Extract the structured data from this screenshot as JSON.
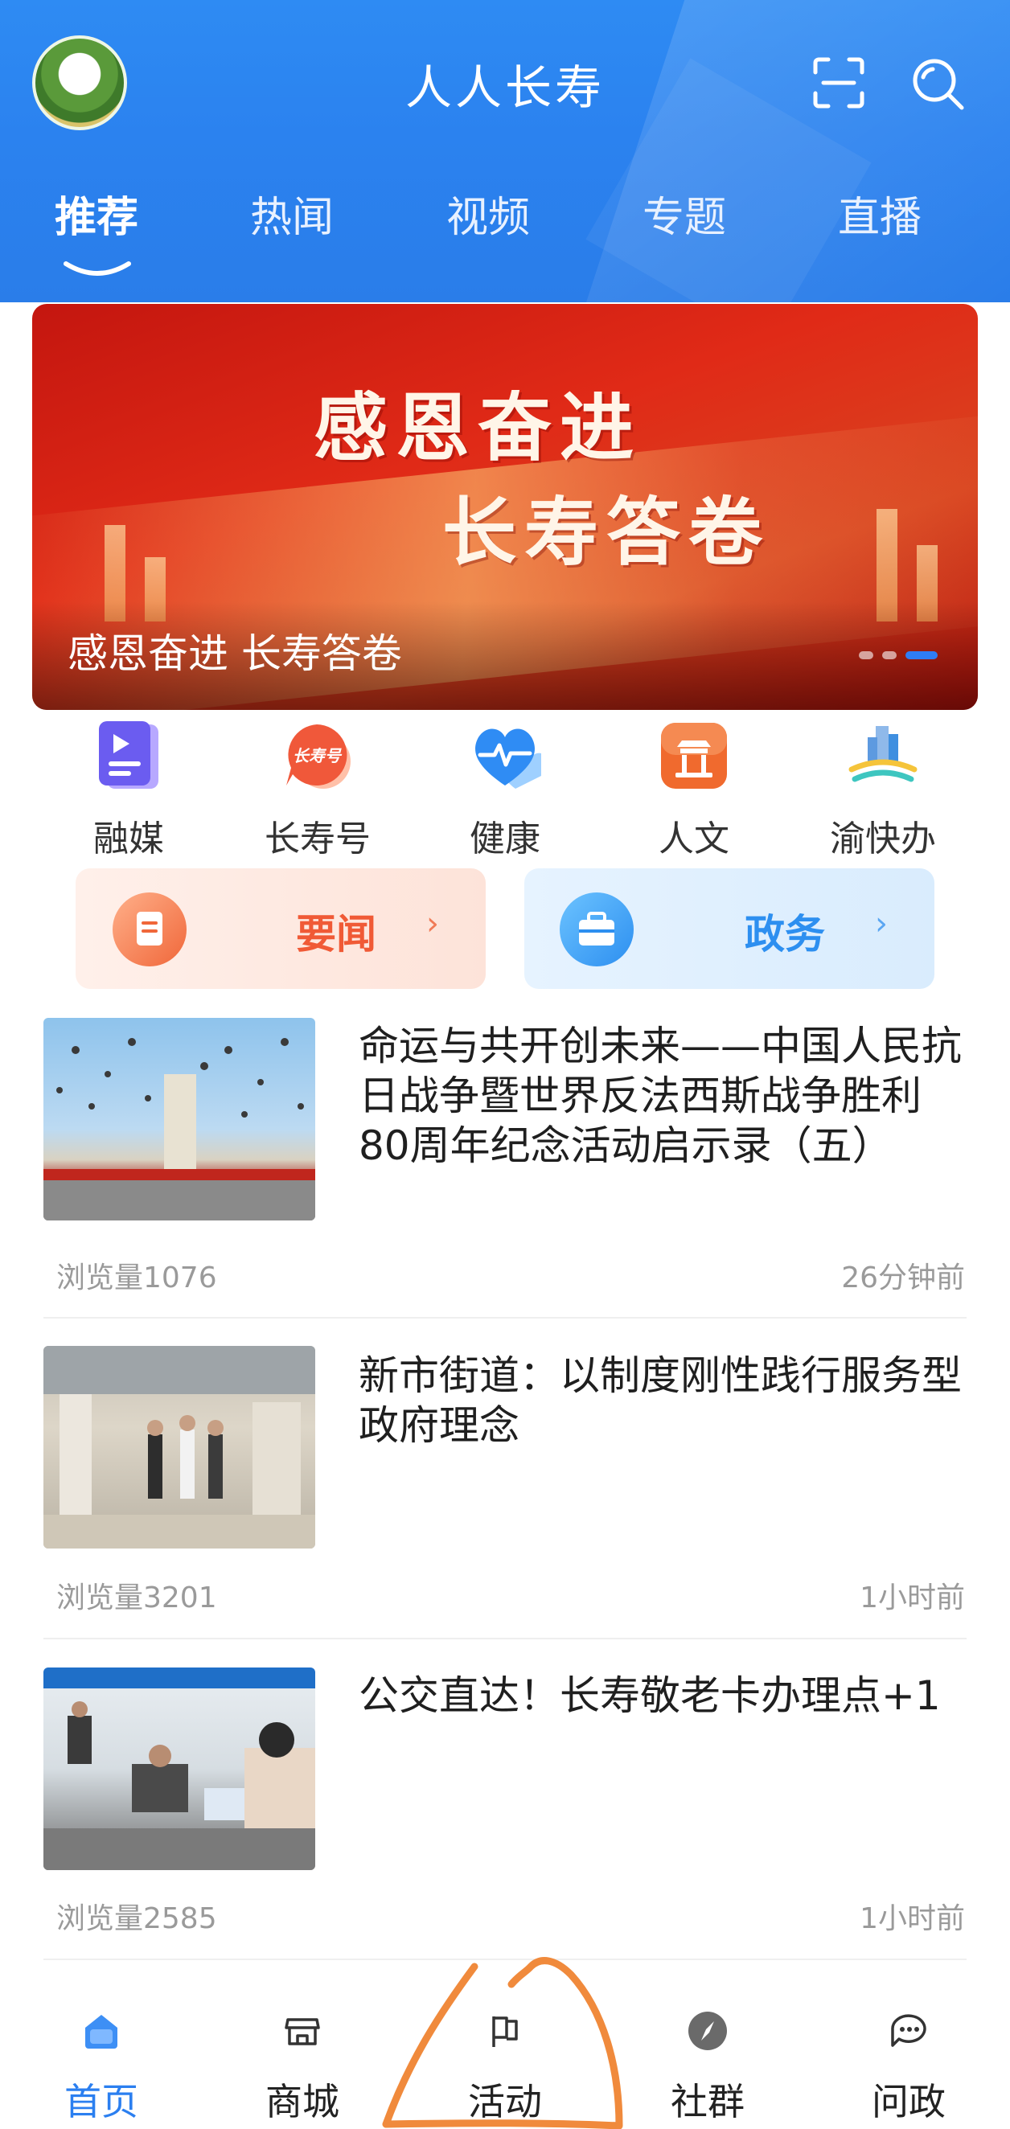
{
  "header": {
    "title": "人人长寿",
    "avatar_icon": "app-logo-icon",
    "scan_icon": "scan-icon",
    "search_icon": "search-icon"
  },
  "tabs": [
    {
      "label": "推荐",
      "active": true
    },
    {
      "label": "热闻",
      "active": false
    },
    {
      "label": "视频",
      "active": false
    },
    {
      "label": "专题",
      "active": false
    },
    {
      "label": "直播",
      "active": false
    }
  ],
  "banner": {
    "line1": "感恩奋进",
    "line2": "长寿答卷",
    "caption": "感恩奋进 长寿答卷",
    "pager": {
      "count": 3,
      "active_index": 2
    }
  },
  "quick_links": [
    {
      "label": "融媒",
      "icon": "media-icon",
      "color": "#6b5cf0"
    },
    {
      "label": "长寿号",
      "icon": "changshou-badge-icon",
      "badge": "长寿号",
      "color": "#f0583a"
    },
    {
      "label": "健康",
      "icon": "health-heart-icon",
      "color": "#2f8cf4"
    },
    {
      "label": "人文",
      "icon": "culture-icon",
      "color": "#f06a2e"
    },
    {
      "label": "渝快办",
      "icon": "yukuaiban-icon",
      "color": "#3f8fe0"
    }
  ],
  "cards": [
    {
      "label": "要闻",
      "icon": "document-icon",
      "color": "#f05a36"
    },
    {
      "label": "政务",
      "icon": "briefcase-icon",
      "color": "#2d8ff0"
    }
  ],
  "news": [
    {
      "title": "命运与共开创未来——中国人民抗日战争暨世界反法西斯战争胜利80周年纪念活动启示录（五）",
      "views": "浏览量1076",
      "time": "26分钟前"
    },
    {
      "title": "新市街道：以制度刚性践行服务型政府理念",
      "views": "浏览量3201",
      "time": "1小时前"
    },
    {
      "title": "公交直达！长寿敬老卡办理点+1",
      "views": "浏览量2585",
      "time": "1小时前"
    }
  ],
  "bottom_nav": [
    {
      "label": "首页",
      "icon": "home-icon",
      "active": true
    },
    {
      "label": "商城",
      "icon": "shop-icon",
      "active": false
    },
    {
      "label": "活动",
      "icon": "flag-icon",
      "active": false
    },
    {
      "label": "社群",
      "icon": "compass-icon",
      "active": false
    },
    {
      "label": "问政",
      "icon": "chat-icon",
      "active": false
    }
  ],
  "colors": {
    "header_blue": "#2b82ef",
    "active_blue": "#2b7ff0",
    "annotation_orange": "#f08a3c"
  }
}
